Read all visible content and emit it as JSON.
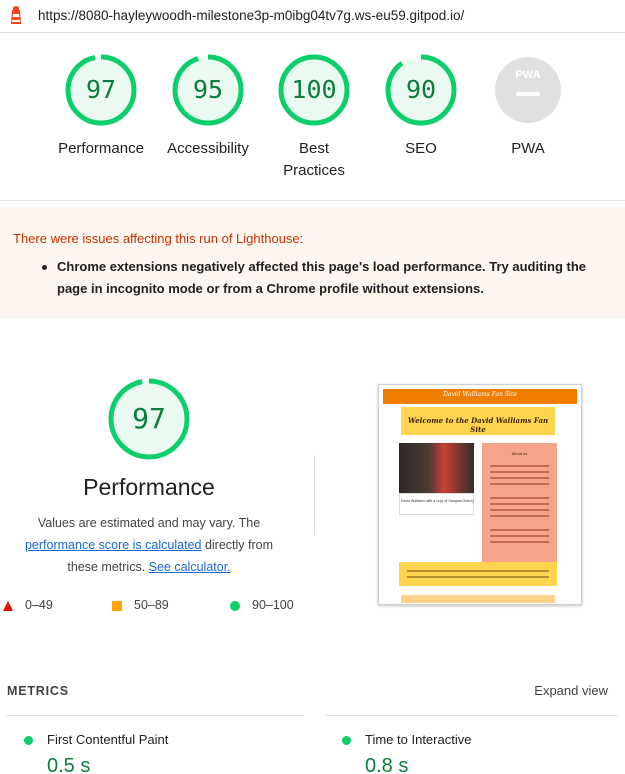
{
  "browser": {
    "url": "https://8080-hayleywoodh-milestone3p-m0ibg04tv7g.ws-eu59.gitpod.io/",
    "icon": "lighthouse-icon"
  },
  "gauges": [
    {
      "score": "97",
      "label": "Performance",
      "fraction": 0.97,
      "color": "#0cce6b"
    },
    {
      "score": "95",
      "label": "Accessibility",
      "fraction": 0.95,
      "color": "#0cce6b"
    },
    {
      "score": "100",
      "label": "Best Practices",
      "fraction": 1.0,
      "color": "#0cce6b"
    },
    {
      "score": "90",
      "label": "SEO",
      "fraction": 0.9,
      "color": "#0cce6b"
    },
    {
      "score": "",
      "label": "PWA",
      "fraction": 0,
      "color": "#cccccc"
    }
  ],
  "pwa_badge": "PWA",
  "warning": {
    "title": "There were issues affecting this run of Lighthouse:",
    "items": [
      "Chrome extensions negatively affected this page's load performance. Try auditing the page in incognito mode or from a Chrome profile without extensions."
    ]
  },
  "performance": {
    "score": "97",
    "fraction": 0.97,
    "title": "Performance",
    "desc_before": "Values are estimated and may vary. The ",
    "desc_link": "performance score is calculated",
    "desc_middle": " directly from these metrics. ",
    "desc_link2": "See calculator."
  },
  "legend": [
    {
      "range": "0–49",
      "shape": "triangle",
      "color": "#eb0f00"
    },
    {
      "range": "50–89",
      "shape": "square",
      "color": "#ffa400"
    },
    {
      "range": "90–100",
      "shape": "circle",
      "color": "#0cce6b"
    }
  ],
  "screenshot": {
    "site_title": "David Walliams Fan Site",
    "welcome": "Welcome to the David Walliams Fan Site",
    "photo_caption": "David Walliams with a copy of Gangsta Granny",
    "about_title": "About us"
  },
  "metrics": {
    "label": "METRICS",
    "expand_label": "Expand view",
    "items": [
      {
        "name": "First Contentful Paint",
        "value": "0.5 s",
        "status": "pass"
      },
      {
        "name": "Time to Interactive",
        "value": "0.8 s",
        "status": "pass"
      }
    ]
  }
}
